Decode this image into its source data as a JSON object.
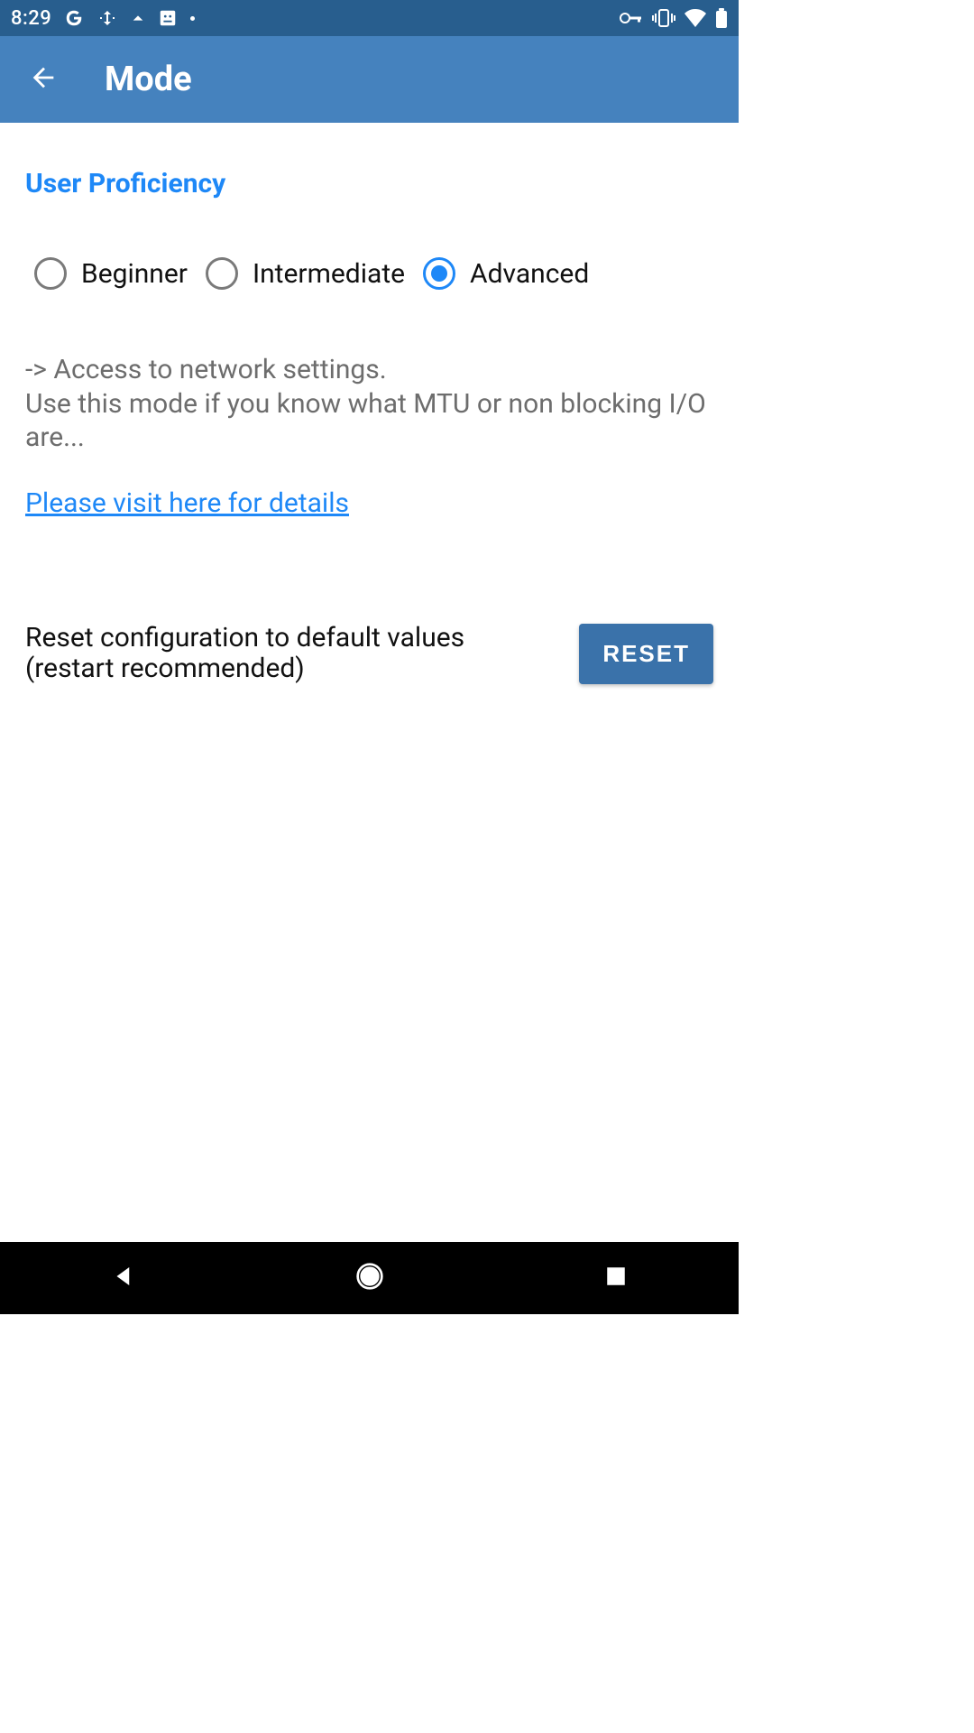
{
  "status": {
    "time": "8:29"
  },
  "appbar": {
    "title": "Mode"
  },
  "section": {
    "title": "User Proficiency"
  },
  "radios": {
    "beginner": {
      "label": "Beginner",
      "selected": false
    },
    "intermediate": {
      "label": "Intermediate",
      "selected": false
    },
    "advanced": {
      "label": "Advanced",
      "selected": true
    }
  },
  "description": "-> Access to network settings.\nUse this mode if you know what MTU or non blocking I/O are...",
  "details_link": "Please visit here for details",
  "reset": {
    "text": "Reset configuration to default values (restart recommended)",
    "button": "RESET"
  }
}
